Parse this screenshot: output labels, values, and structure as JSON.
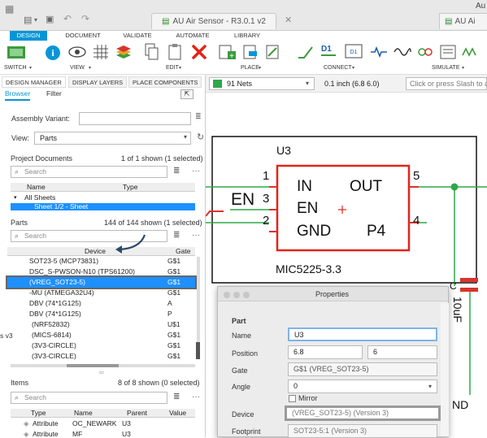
{
  "window": {
    "app_title": "Au",
    "doc_tab": "AU Air Sensor - R3.0.1 v2",
    "doc_tab2": "AU Ai"
  },
  "menu": {
    "tabs": [
      "DESIGN",
      "DOCUMENT",
      "VALIDATE",
      "AUTOMATE",
      "LIBRARY"
    ]
  },
  "ribbon": {
    "groups": [
      "SWITCH",
      "VIEW",
      "EDIT",
      "PLACE",
      "CONNECT",
      "SIMULATE"
    ]
  },
  "panel": {
    "tabs": [
      "DESIGN MANAGER",
      "DISPLAY LAYERS",
      "PLACE COMPONENTS"
    ],
    "subtabs": [
      "Browser",
      "Filter"
    ],
    "assembly_label": "Assembly Variant:",
    "view_label": "View:",
    "view_value": "Parts",
    "project_docs": {
      "title": "Project Documents",
      "count": "1 of 1 shown (1 selected)",
      "search_placeholder": "Search",
      "headers": [
        "Name",
        "Type"
      ],
      "rows": [
        "All Sheets",
        "Sheet 1/2 - Sheet"
      ]
    },
    "parts": {
      "title": "Parts",
      "count": "144 of 144 shown (1 selected)",
      "search_placeholder": "Search",
      "headers": [
        "Device",
        "Gate"
      ],
      "rows": [
        {
          "device": "SOT23-5 (MCP73831)",
          "gate": "G$1"
        },
        {
          "device": "DSC_S-PWSON-N10 (TPS61200)",
          "gate": "G$1"
        },
        {
          "device": "(VREG_SOT23-5)",
          "gate": "G$1"
        },
        {
          "device": "-MU (ATMEGA32U4)",
          "gate": "G$1"
        },
        {
          "device": "DBV (74*1G125)",
          "gate": "A"
        },
        {
          "device": "DBV (74*1G125)",
          "gate": "P"
        },
        {
          "device": "(NRF52832)",
          "gate": "U$1"
        },
        {
          "device": "(MICS-6814)",
          "gate": "G$1"
        },
        {
          "device": "(3V3-CIRCLE)",
          "gate": "G$1"
        },
        {
          "device": "(3V3-CIRCLE)",
          "gate": "G$1"
        }
      ],
      "side_text": "s v3"
    },
    "items": {
      "title": "Items",
      "count": "8 of 8 shown (0 selected)",
      "search_placeholder": "Search",
      "headers": [
        "Type",
        "Name",
        "Parent",
        "Value"
      ],
      "rows": [
        {
          "type": "Attribute",
          "name": "OC_NEWARK",
          "parent": "U3"
        },
        {
          "type": "Attribute",
          "name": "MF",
          "parent": "U3"
        }
      ]
    }
  },
  "canvas": {
    "nets_label": "91 Nets",
    "grid": "0.1 inch (6.8 6.0)",
    "command_placeholder": "Click or press Slash to a",
    "part_name": "U3",
    "part_value": "MIC5225-3.3",
    "pins": {
      "in": "IN",
      "out": "OUT",
      "en": "EN",
      "gnd": "GND",
      "p4": "P4"
    },
    "pin_numbers": {
      "in": "1",
      "en": "3",
      "gnd": "2",
      "out": "5",
      "p4": "4"
    },
    "net_label": "EN",
    "side_labels": {
      "c": "C",
      "gnd": "ND",
      "val": "10uF"
    }
  },
  "properties": {
    "title": "Properties",
    "section": "Part",
    "name_label": "Name",
    "name_value": "U3",
    "position_label": "Position",
    "pos_x": "6.8",
    "pos_y": "6",
    "gate_label": "Gate",
    "gate_value": "G$1 (VREG_SOT23-5)",
    "angle_label": "Angle",
    "angle_value": "0",
    "mirror_label": "Mirror",
    "device_label": "Device",
    "device_value": "(VREG_SOT23-5) (Version 3)",
    "footprint_label": "Footprint",
    "footprint_value": "SOT23-5:1 (Version 3)"
  }
}
